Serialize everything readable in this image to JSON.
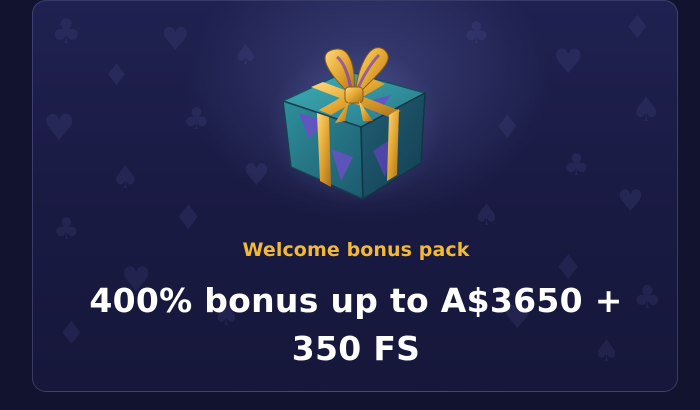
{
  "promo": {
    "label": "Welcome bonus pack",
    "title": "400% bonus up to A$3650 + 350 FS"
  },
  "icons": {
    "gift": "gift-box-icon",
    "background_pattern": "card-suits-pattern"
  },
  "colors": {
    "background": "#12132e",
    "card": "#1f2150",
    "label": "#f3b935",
    "title": "#ffffff"
  }
}
